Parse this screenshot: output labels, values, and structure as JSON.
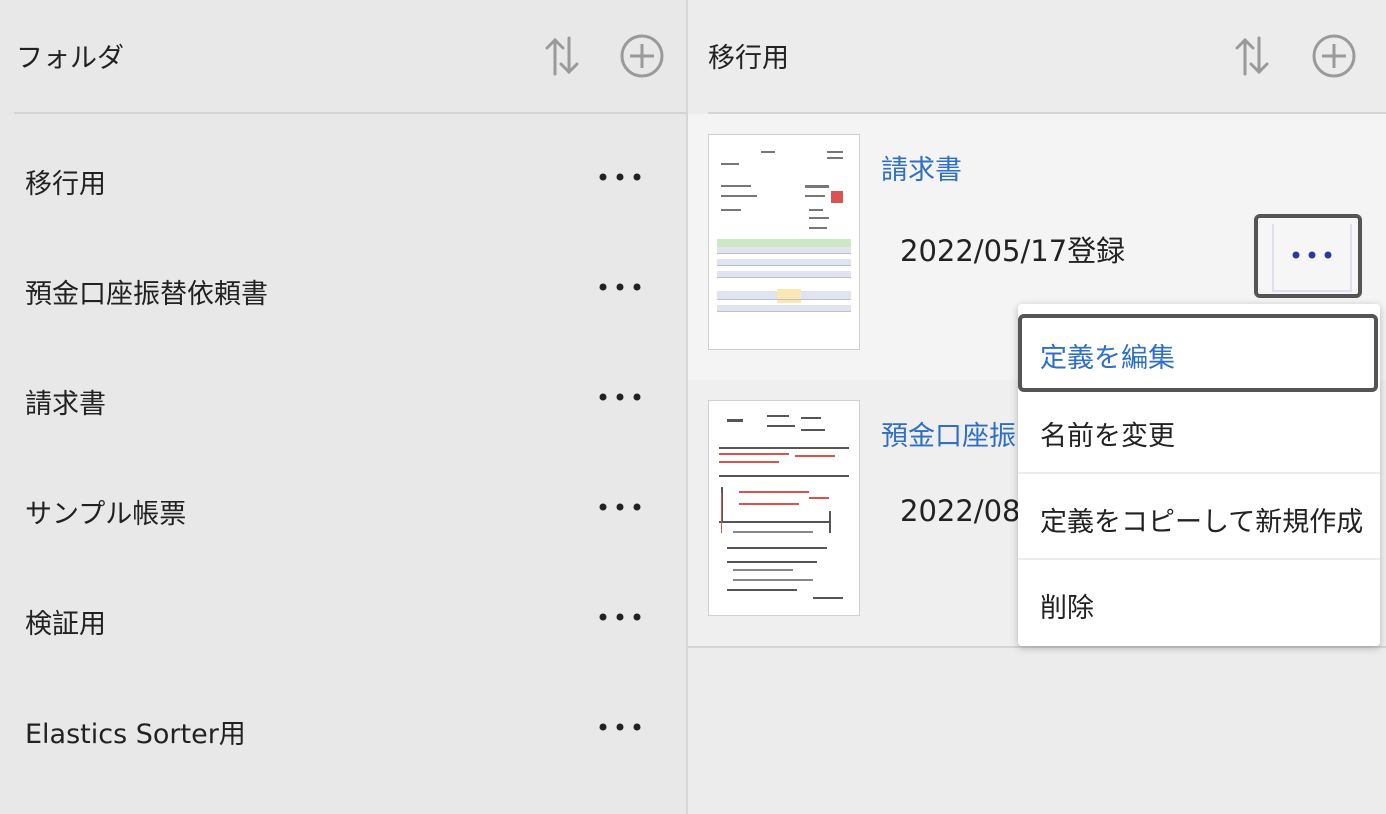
{
  "left_panel": {
    "title": "フォルダ",
    "icons": {
      "sort": "sort-icon",
      "add": "add-circle-icon"
    },
    "folders": [
      {
        "label": "移行用"
      },
      {
        "label": "預金口座振替依頼書"
      },
      {
        "label": "請求書"
      },
      {
        "label": "サンプル帳票"
      },
      {
        "label": "検証用"
      },
      {
        "label": "Elastics Sorter用"
      }
    ],
    "more_icon": "more-horizontal-icon"
  },
  "right_panel": {
    "title": "移行用",
    "cards": [
      {
        "title": "請求書",
        "date": "2022/05/17登録",
        "thumbnail": "invoice-thumbnail"
      },
      {
        "title": "預金口座振",
        "date": "2022/08",
        "thumbnail": "form-thumbnail"
      }
    ]
  },
  "context_menu": {
    "items": [
      {
        "label": "定義を編集"
      },
      {
        "label": "名前を変更"
      },
      {
        "label": "定義をコピーして新規作成"
      },
      {
        "label": "削除"
      }
    ]
  },
  "colors": {
    "accent": "#2f6fc4",
    "dots_active": "#2c3a9c",
    "dots": "#222222"
  }
}
